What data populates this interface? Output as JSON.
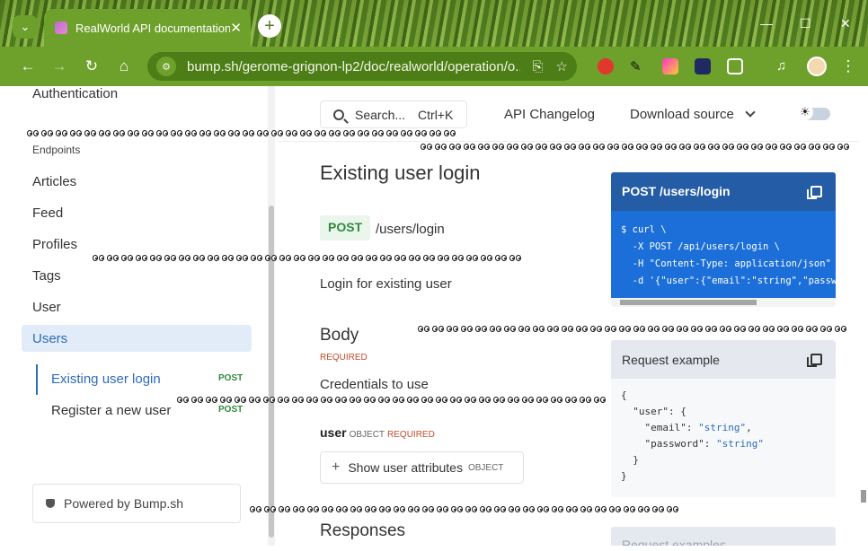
{
  "browser": {
    "tab_title": "RealWorld API documentation",
    "url": "bump.sh/gerome-grignon-lp2/doc/realworld/operation/o..."
  },
  "sidebar": {
    "auth": "Authentication",
    "section": "Endpoints",
    "items": [
      "Articles",
      "Feed",
      "Profiles",
      "Tags",
      "User"
    ],
    "active": "Users",
    "sub": [
      {
        "label": "Existing user login",
        "method": "POST"
      },
      {
        "label": "Register a new user",
        "method": "POST"
      }
    ],
    "powered": "Powered by Bump.sh"
  },
  "topbar": {
    "search": "Search...",
    "shortcut": "Ctrl+K",
    "changelog": "API Changelog",
    "download": "Download source"
  },
  "content": {
    "title": "Existing user login",
    "method": "POST",
    "path": "/users/login",
    "description": "Login for existing user",
    "body_title": "Body",
    "required": "REQUIRED",
    "body_desc": "Credentials to use",
    "field_name": "user",
    "field_type": "OBJECT",
    "field_required": "REQUIRED",
    "attr_button": "Show user attributes",
    "attr_type": "OBJECT",
    "responses": "Responses"
  },
  "code": {
    "title": "POST /users/login",
    "lines": "$ curl \\\n  -X POST /api/users/login \\\n  -H \"Content-Type: application/json\" \\\n  -d '{\"user\":{\"email\":\"string\",\"password\":\"string\"}}'",
    "req_title": "Request example",
    "req_title2": "Request examples"
  },
  "colors": {
    "primary": "#2d6cb8",
    "post": "#2f8a3c",
    "chrome": "#6ea12b"
  }
}
